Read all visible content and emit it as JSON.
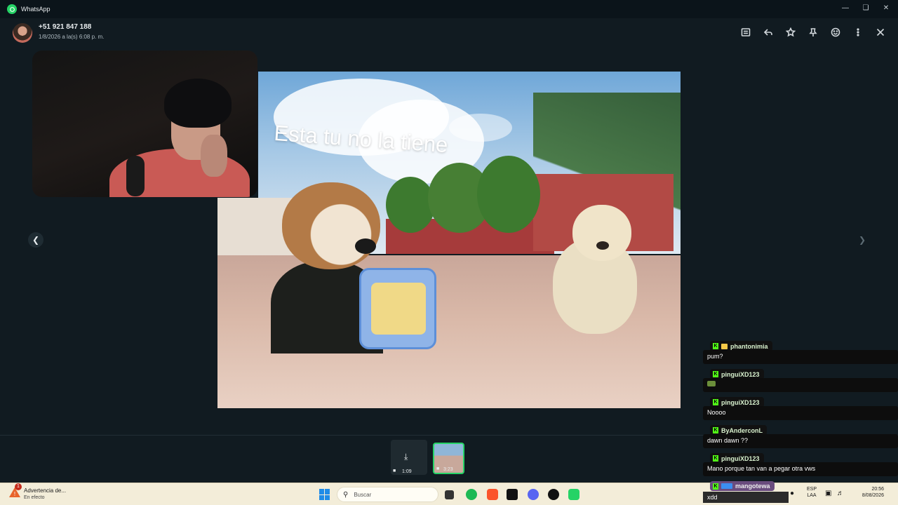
{
  "window": {
    "title": "WhatsApp"
  },
  "header": {
    "contact_name": "+51 921 847 188",
    "contact_date": "1/8/2026 a la(s) 6:08 p. m."
  },
  "media": {
    "overlay_text": "Esta tu no la tiene"
  },
  "thumbnails": [
    {
      "duration": "1:09"
    },
    {
      "duration": "3:23"
    }
  ],
  "chat": [
    {
      "user": "phantonimia",
      "message": "pum?"
    },
    {
      "user": "pinguiXD123",
      "message": ""
    },
    {
      "user": "pinguiXD123",
      "message": "Noooo"
    },
    {
      "user": "ByAnderconL",
      "message": "dawn dawn ??"
    },
    {
      "user": "pinguiXD123",
      "message": "Mano porque tan van a pegar otra vws"
    },
    {
      "user": "mangotewa",
      "message": "xdd"
    }
  ],
  "taskbar": {
    "notification_title": "Advertencia de...",
    "notification_subtitle": "En efecto",
    "notification_count": "1",
    "search_placeholder": "Buscar",
    "lang_top": "ESP",
    "lang_bottom": "LAA",
    "time": "20:56",
    "date": "8/08/2026"
  },
  "colors": {
    "accent": "#25d366",
    "background": "#111b21",
    "kick": "#53fc18"
  }
}
